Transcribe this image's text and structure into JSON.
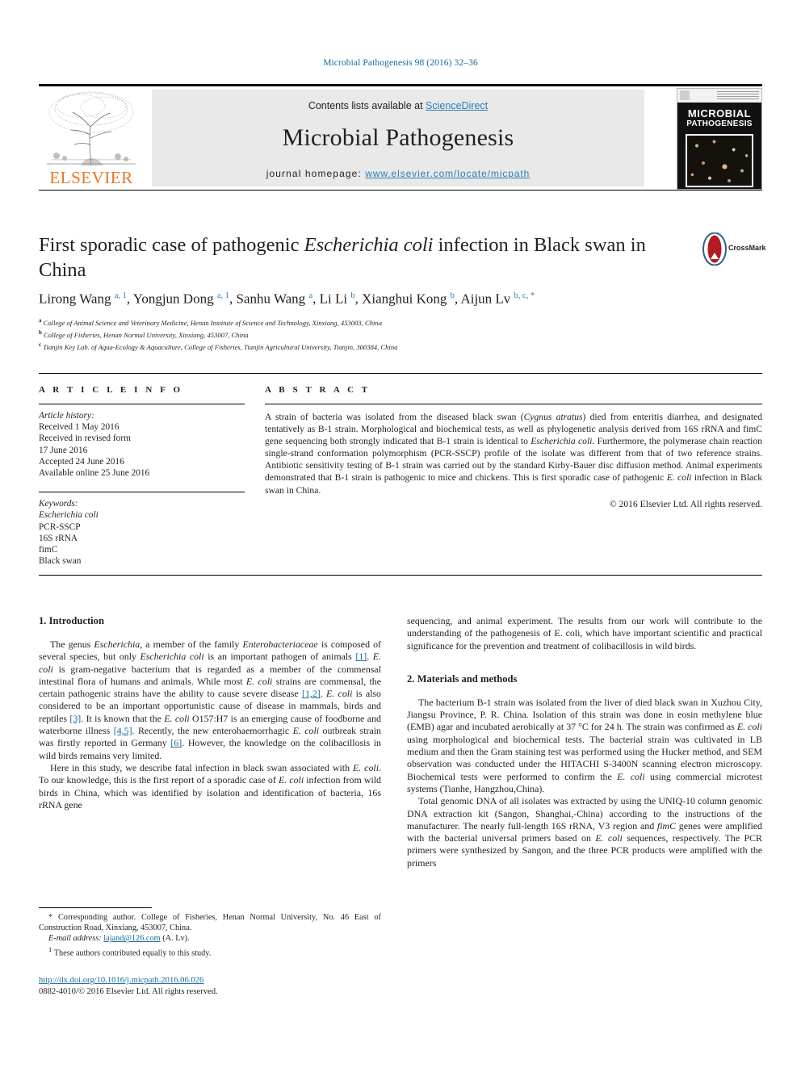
{
  "running_head": "Microbial Pathogenesis 98 (2016) 32–36",
  "masthead": {
    "publisher": "ELSEVIER",
    "contents_prefix": "Contents lists available at ",
    "contents_link": "ScienceDirect",
    "journal_name": "Microbial Pathogenesis",
    "homepage_label": "journal homepage: ",
    "homepage_url": "www.elsevier.com/locate/micpath",
    "cover_title_line1": "MICROBIAL",
    "cover_title_line2": "PATHOGENESIS"
  },
  "article": {
    "title_part1": "First sporadic case of pathogenic ",
    "title_italic": "Escherichia coli",
    "title_part2": " infection in Black swan in China",
    "crossmark_label": "CrossMark",
    "authors": [
      {
        "name": "Lirong Wang",
        "sup": "a, 1",
        "sep": ", "
      },
      {
        "name": "Yongjun Dong",
        "sup": "a, 1",
        "sep": ", "
      },
      {
        "name": "Sanhu Wang",
        "sup": "a",
        "sep": ", "
      },
      {
        "name": "Li Li",
        "sup": "b",
        "sep": ", "
      },
      {
        "name": "Xianghui Kong",
        "sup": "b",
        "sep": ", "
      },
      {
        "name": "Aijun Lv",
        "sup": "b, c, *",
        "sep": ""
      }
    ],
    "affiliations": [
      {
        "mark": "a",
        "text": "College of Animal Science and Veterinary Medicine, Henan Institute of Science and Technology, Xinxiang, 453003, China"
      },
      {
        "mark": "b",
        "text": "College of Fisheries, Henan Normal University, Xinxiang, 453007, China"
      },
      {
        "mark": "c",
        "text": "Tianjin Key Lab. of Aqua-Ecology & Aquaculture, College of Fisheries, Tianjin Agricultural University, Tianjin, 300384, China"
      }
    ]
  },
  "article_info": {
    "heading": "A R T I C L E   I N F O",
    "history_label": "Article history:",
    "history": [
      "Received 1 May 2016",
      "Received in revised form",
      "17 June 2016",
      "Accepted 24 June 2016",
      "Available online 25 June 2016"
    ],
    "keywords_label": "Keywords:",
    "keywords": [
      "Escherichia coli",
      "PCR-SSCP",
      "16S rRNA",
      "fimC",
      "Black swan"
    ]
  },
  "abstract": {
    "heading": "A B S T R A C T",
    "p1_a": "A strain of bacteria was isolated from the diseased black swan (",
    "p1_italic1": "Cygnus atratus",
    "p1_b": ") died from enteritis diarrhea, and designated tentatively as B-1 strain. Morphological and biochemical tests, as well as phylogenetic analysis derived from 16S rRNA and fimC gene sequencing both strongly indicated that B-1 strain is identical to ",
    "p1_italic2": "Escherichia coli",
    "p1_c": ". Furthermore, the polymerase chain reaction single-strand conformation polymorphism (PCR-SSCP) profile of the isolate was different from that of two reference strains. Antibiotic sensitivity testing of B-1 strain was carried out by the standard Kirby-Bauer disc diffusion method. Animal experiments demonstrated that B-1 strain is pathogenic to mice and chickens. This is first sporadic case of pathogenic ",
    "p1_italic3": "E. coli",
    "p1_d": " infection in Black swan in China.",
    "copyright": "© 2016 Elsevier Ltd. All rights reserved."
  },
  "sections": {
    "intro_heading": "1. Introduction",
    "intro_p1_a": "The genus ",
    "intro_p1_i1": "Escherichia",
    "intro_p1_b": ", a member of the family ",
    "intro_p1_i2": "Enterobacteriaceae",
    "intro_p1_c": " is composed of several species, but only ",
    "intro_p1_i3": "Escherichia coli",
    "intro_p1_d": " is an important pathogen of animals ",
    "intro_p1_r1": "[1]",
    "intro_p1_e": ". ",
    "intro_p1_i4": "E. coli",
    "intro_p1_f": " is gram-negative bacterium that is regarded as a member of the commensal intestinal flora of humans and animals. While most ",
    "intro_p1_i5": "E. coli",
    "intro_p1_g": " strains are commensal, the certain pathogenic strains have the ability to cause severe disease ",
    "intro_p1_r2": "[1,2]",
    "intro_p1_h": ". ",
    "intro_p1_i6": "E. coli",
    "intro_p1_j": " is also considered to be an important opportunistic cause of disease in mammals, birds and reptiles ",
    "intro_p1_r3": "[3]",
    "intro_p1_k": ". It is known that the ",
    "intro_p1_i7": "E. coli",
    "intro_p1_l": " O157:H7 is an emerging cause of foodborne and waterborne illness ",
    "intro_p1_r4": "[4,5]",
    "intro_p1_m": ". Recently, the new enterohaemorrhagic ",
    "intro_p1_i8": "E. coli",
    "intro_p1_n": " outbreak strain was firstly reported in Germany ",
    "intro_p1_r5": "[6]",
    "intro_p1_o": ". However, the knowledge on the colibacillosis in wild birds remains very limited.",
    "intro_p2_a": "Here in this study, we describe fatal infection in black swan associated with ",
    "intro_p2_i1": "E. coli",
    "intro_p2_b": ". To our knowledge, this is the first report of a sporadic case of ",
    "intro_p2_i2": "E. coli",
    "intro_p2_c": " infection from wild birds in China, which was identified by isolation and identification of bacteria, 16s rRNA gene sequencing, and animal experiment. The results from our work will contribute to the understanding of the pathogenesis of ",
    "intro_p2_i3": "E. coli",
    "intro_p2_d": ", which have important scientific and practical significance for the prevention and treatment of colibacillosis in wild birds.",
    "methods_heading": "2. Materials and methods",
    "methods_p1_a": "The bacterium B-1 strain was isolated from the liver of died black swan in Xuzhou City, Jiangsu Province, P. R. China. Isolation of this strain was done in eosin methylene blue (EMB) agar and incubated aerobically at 37 °C for 24 h. The strain was confirmed as ",
    "methods_p1_i1": "E. coli",
    "methods_p1_b": " using morphological and biochemical tests. The bacterial strain was cultivated in LB medium and then the Gram staining test was performed using the Hucker method, and SEM observation was conducted under the HITACHI S-3400N scanning electron microscopy. Biochemical tests were performed to confirm the ",
    "methods_p1_i2": "E. coli",
    "methods_p1_c": " using commercial microtest systems (Tianhe, Hangzhou,China).",
    "methods_p2_a": "Total genomic DNA of all isolates was extracted by using the UNIQ-10 column genomic DNA extraction kit (Sangon, Shanghai,-China) according to the instructions of the manufacturer. The nearly full-length 16S rRNA, V3 region and ",
    "methods_p2_i1": "fimC",
    "methods_p2_b": " genes were amplified with the bacterial universal primers based on ",
    "methods_p2_i2": "E. coli",
    "methods_p2_c": " sequences, respectively. The PCR primers were synthesized by Sangon, and the three PCR products were amplified with the primers"
  },
  "footnotes": {
    "corresponding": "* Corresponding author. College of Fisheries, Henan Normal University, No. 46 East of Construction Road, Xinxiang, 453007, China.",
    "email_label": "E-mail address: ",
    "email": "lajand@126.com",
    "email_suffix": " (A. Lv).",
    "equal_mark": "1",
    "equal_contrib": "These authors contributed equally to this study."
  },
  "footer": {
    "doi": "http://dx.doi.org/10.1016/j.micpath.2016.06.026",
    "issn": "0882-4010/© 2016 Elsevier Ltd. All rights reserved."
  },
  "colors": {
    "link_blue": "#1a6b9c",
    "sd_blue": "#2b7db5",
    "elsevier_orange": "#E87722",
    "crossmark_red": "#b01c20"
  }
}
